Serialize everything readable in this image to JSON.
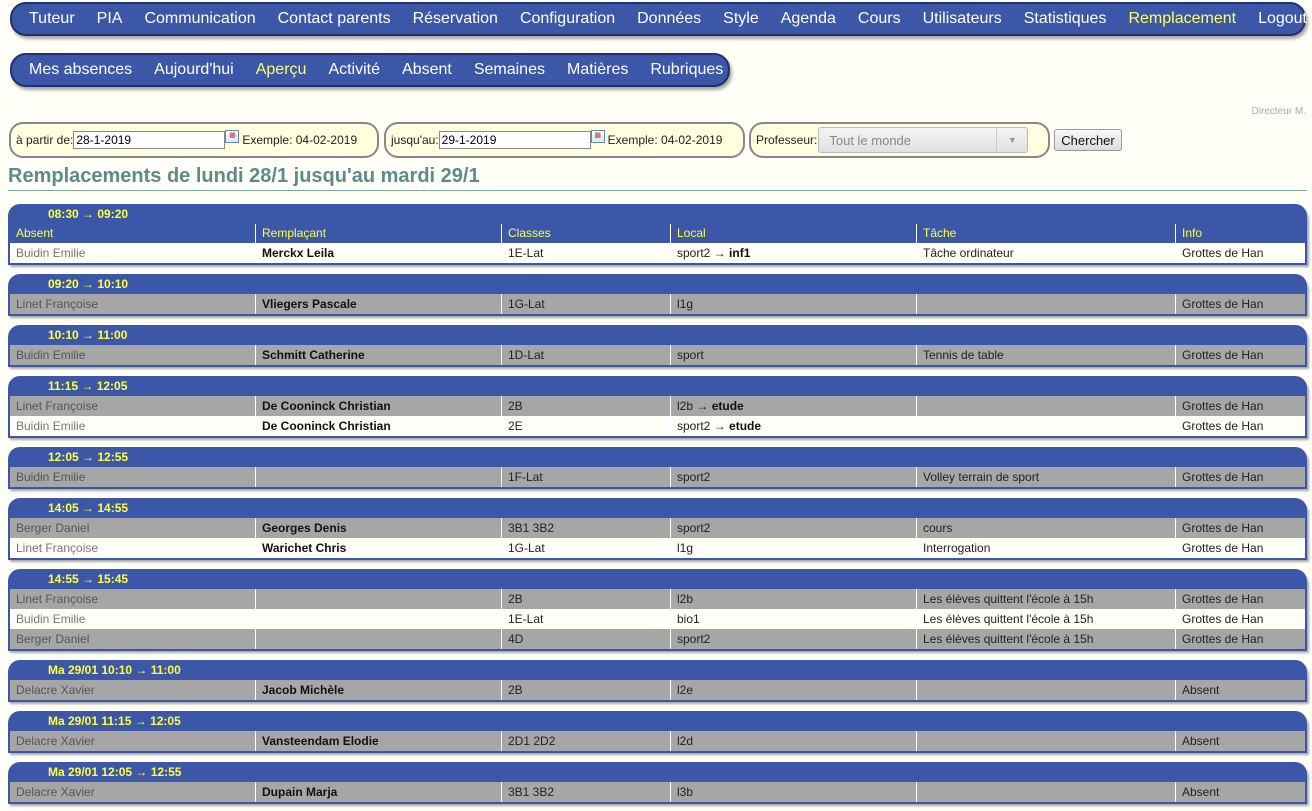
{
  "main_nav": [
    "Tuteur",
    "PIA",
    "Communication",
    "Contact parents",
    "Réservation",
    "Configuration",
    "Données",
    "Style",
    "Agenda",
    "Cours",
    "Utilisateurs",
    "Statistiques",
    "Remplacement",
    "Logout"
  ],
  "main_nav_active": "Remplacement",
  "sub_nav": [
    "Mes absences",
    "Aujourd'hui",
    "Aperçu",
    "Activité",
    "Absent",
    "Semaines",
    "Matières",
    "Rubriques"
  ],
  "sub_nav_active": "Aperçu",
  "user": "Directeur M.",
  "filter": {
    "from_label": "à partir de:",
    "from_value": "28-1-2019",
    "from_example": "Exemple: 04-02-2019",
    "to_label": "jusqu'au:",
    "to_value": "29-1-2019",
    "to_example": "Exemple: 04-02-2019",
    "prof_label": "Professeur:",
    "prof_value": "Tout le monde",
    "search_button": "Chercher"
  },
  "page_title": "Remplacements de lundi 28/1 jusqu'au mardi 29/1",
  "columns": [
    "Absent",
    "Remplaçant",
    "Classes",
    "Local",
    "Tâche",
    "Info"
  ],
  "blocks": [
    {
      "time": "08:30 → 09:20",
      "rows": [
        {
          "absent": "Buidin Emilie",
          "replacement": "Merckx Leila",
          "classes": "1E-Lat",
          "local": "sport2",
          "local_to": "inf1",
          "task": "Tâche ordinateur",
          "info": "Grottes de Han"
        }
      ]
    },
    {
      "time": "09:20 → 10:10",
      "rows": [
        {
          "absent": "Linet Françoise",
          "replacement": "Vliegers Pascale",
          "classes": "1G-Lat",
          "local": "l1g",
          "local_to": "",
          "task": "",
          "info": "Grottes de Han"
        }
      ]
    },
    {
      "time": "10:10 → 11:00",
      "rows": [
        {
          "absent": "Buidin Emilie",
          "replacement": "Schmitt Catherine",
          "classes": "1D-Lat",
          "local": "sport",
          "local_to": "",
          "task": "Tennis de table",
          "info": "Grottes de Han"
        }
      ]
    },
    {
      "time": "11:15 → 12:05",
      "rows": [
        {
          "absent": "Linet Françoise",
          "replacement": "De Cooninck Christian",
          "classes": "2B",
          "local": "l2b",
          "local_to": "etude",
          "task": "",
          "info": "Grottes de Han"
        },
        {
          "absent": "Buidin Emilie",
          "replacement": "De Cooninck Christian",
          "classes": "2E",
          "local": "sport2",
          "local_to": "etude",
          "task": "",
          "info": "Grottes de Han"
        }
      ]
    },
    {
      "time": "12:05 → 12:55",
      "rows": [
        {
          "absent": "Buidin Emilie",
          "replacement": "",
          "classes": "1F-Lat",
          "local": "sport2",
          "local_to": "",
          "task": "Volley terrain de sport",
          "info": "Grottes de Han"
        }
      ]
    },
    {
      "time": "14:05 → 14:55",
      "rows": [
        {
          "absent": "Berger Daniel",
          "replacement": "Georges Denis",
          "classes": "3B1 3B2",
          "local": "sport2",
          "local_to": "",
          "task": "cours",
          "info": "Grottes de Han"
        },
        {
          "absent": "Linet Françoise",
          "replacement": "Warichet Chris",
          "classes": "1G-Lat",
          "local": "l1g",
          "local_to": "",
          "task": "Interrogation",
          "info": "Grottes de Han"
        }
      ]
    },
    {
      "time": "14:55 → 15:45",
      "rows": [
        {
          "absent": "Linet Françoise",
          "replacement": "",
          "classes": "2B",
          "local": "l2b",
          "local_to": "",
          "task": "Les élèves quittent l'école à 15h",
          "info": "Grottes de Han"
        },
        {
          "absent": "Buidin Emilie",
          "replacement": "",
          "classes": "1E-Lat",
          "local": "bio1",
          "local_to": "",
          "task": "Les élèves quittent l'école à 15h",
          "info": "Grottes de Han"
        },
        {
          "absent": "Berger Daniel",
          "replacement": "",
          "classes": "4D",
          "local": "sport2",
          "local_to": "",
          "task": "Les élèves quittent l'école à 15h",
          "info": "Grottes de Han"
        }
      ]
    },
    {
      "time": "Ma 29/01 10:10 → 11:00",
      "rows": [
        {
          "absent": "Delacre Xavier",
          "replacement": "Jacob Michèle",
          "classes": "2B",
          "local": "l2e",
          "local_to": "",
          "task": "",
          "info": "Absent"
        }
      ]
    },
    {
      "time": "Ma 29/01 11:15 → 12:05",
      "rows": [
        {
          "absent": "Delacre Xavier",
          "replacement": "Vansteendam Elodie",
          "classes": "2D1 2D2",
          "local": "l2d",
          "local_to": "",
          "task": "",
          "info": "Absent"
        }
      ]
    },
    {
      "time": "Ma 29/01 12:05 → 12:55",
      "rows": [
        {
          "absent": "Delacre Xavier",
          "replacement": "Dupain Marja",
          "classes": "3B1 3B2",
          "local": "l3b",
          "local_to": "",
          "task": "",
          "info": "Absent"
        }
      ]
    }
  ]
}
